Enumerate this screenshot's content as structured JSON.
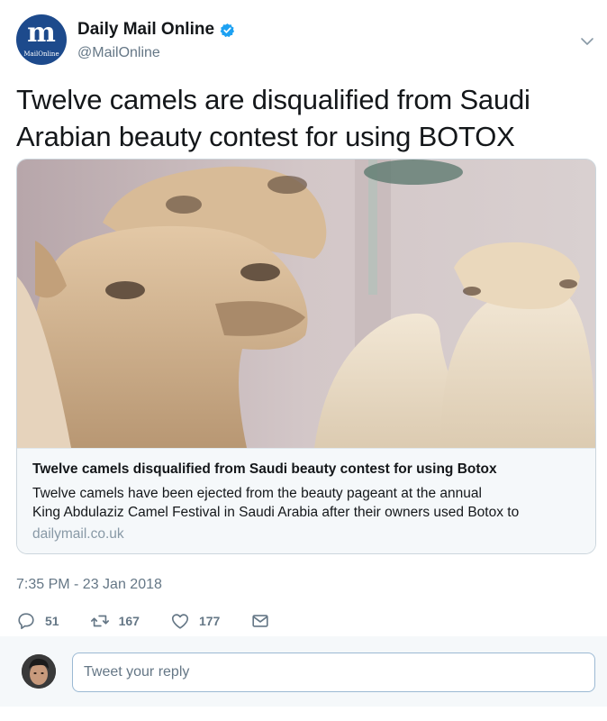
{
  "account": {
    "name": "Daily Mail Online",
    "handle": "@MailOnline",
    "avatar_letter": "m",
    "avatar_sub": "MailOnline",
    "verified_icon": "verified-badge-icon"
  },
  "tweet": {
    "text": "Twelve camels are disqualified from Saudi Arabian beauty contest for using BOTOX",
    "timestamp": "7:35 PM - 23 Jan 2018"
  },
  "card": {
    "image": "camel-photo",
    "title": "Twelve camels disqualified from Saudi beauty contest for using Botox",
    "description_line1": "Twelve camels have been ejected from the beauty pageant at the annual",
    "description_line2": "King Abdulaziz Camel Festival in Saudi Arabia after their owners used Botox to",
    "domain": "dailymail.co.uk"
  },
  "actions": {
    "reply_count": "51",
    "retweet_count": "167",
    "like_count": "177",
    "icons": [
      "reply-icon",
      "retweet-icon",
      "like-icon",
      "direct-message-icon"
    ]
  },
  "reply": {
    "placeholder": "Tweet your reply"
  },
  "colors": {
    "text": "#14171a",
    "secondary": "#657786",
    "verified": "#1da1f2",
    "brand": "#1d4a8c"
  }
}
